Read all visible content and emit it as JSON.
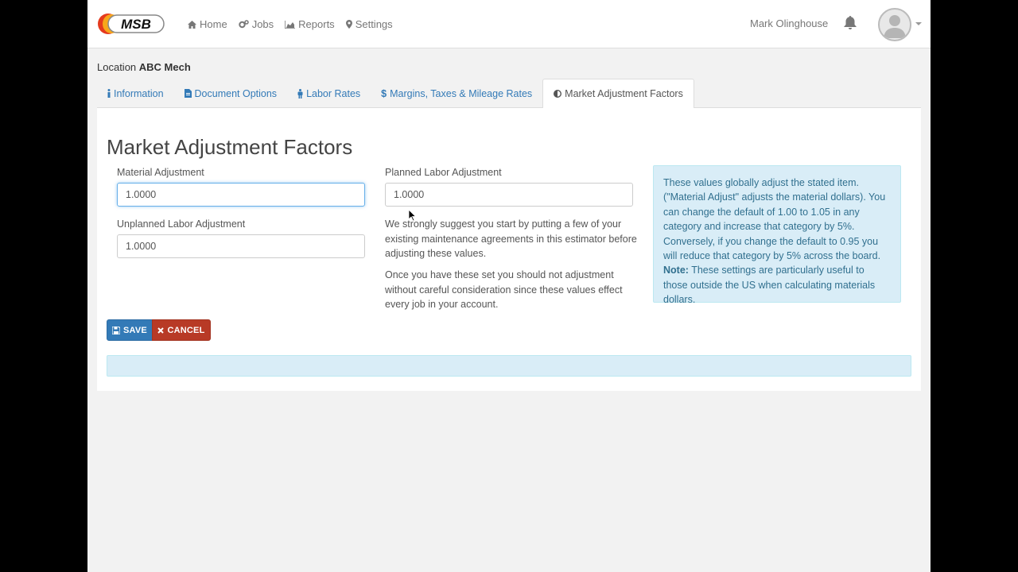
{
  "nav": {
    "brand": "MSB",
    "links": [
      {
        "label": "Home",
        "icon": "home-icon"
      },
      {
        "label": "Jobs",
        "icon": "gears-icon"
      },
      {
        "label": "Reports",
        "icon": "area-chart-icon"
      },
      {
        "label": "Settings",
        "icon": "map-marker-icon"
      }
    ],
    "user_name": "Mark Olinghouse"
  },
  "location": {
    "label": "Location",
    "name": "ABC Mech"
  },
  "tabs": [
    {
      "label": "Information",
      "icon": "info-icon"
    },
    {
      "label": "Document Options",
      "icon": "file-text-icon"
    },
    {
      "label": "Labor Rates",
      "icon": "male-icon"
    },
    {
      "label": "Margins, Taxes & Mileage Rates",
      "icon": "dollar-icon"
    },
    {
      "label": "Market Adjustment Factors",
      "icon": "adjust-icon",
      "active": true
    }
  ],
  "page": {
    "title": "Market Adjustment Factors",
    "material_label": "Material Adjustment",
    "material_value": "1.0000",
    "unplanned_label": "Unplanned Labor Adjustment",
    "unplanned_value": "1.0000",
    "planned_label": "Planned Labor Adjustment",
    "planned_value": "1.0000",
    "para1": "We strongly suggest you start by putting a few of your existing maintenance agreements in this estimator before adjusting these values.",
    "para2": "Once you have these set you should not adjustment without careful consideration since these values effect every job in your account.",
    "info_text": "These values globally adjust the stated item. (\"Material Adjust\" adjusts the material dollars). You can change the default of 1.00 to 1.05 in any category and increase that category by 5%. Conversely, if you change the default to 0.95 you will reduce that category by 5% across the board.",
    "info_note_label": "Note:",
    "info_note_text": " These settings are particularly useful to those outside the US when calculating materials dollars.",
    "save_label": "SAVE",
    "cancel_label": "CANCEL"
  },
  "colors": {
    "primary": "#337ab7",
    "danger": "#b83a26",
    "info_bg": "#d9edf7",
    "info_text": "#31708f"
  }
}
